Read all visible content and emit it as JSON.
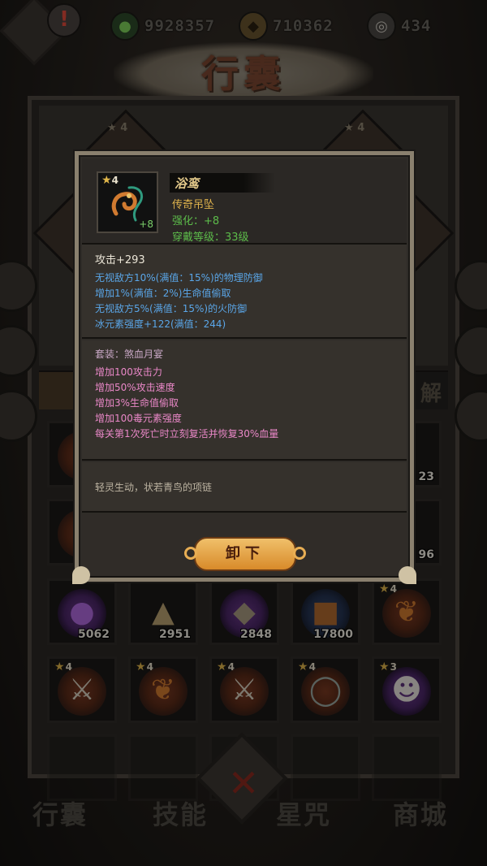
{
  "resources": {
    "jade": "9928357",
    "coin": "710362",
    "spirit": "434"
  },
  "header": {
    "title": "行囊"
  },
  "background": {
    "equip_star_left": "4",
    "equip_star_right": "4",
    "tab_right_label": "解"
  },
  "grid": {
    "row1": [
      {
        "name": "bag-slot",
        "count": ""
      },
      {
        "name": "bag-slot",
        "count": ""
      },
      {
        "name": "bag-slot",
        "count": ""
      },
      {
        "name": "bag-slot",
        "count": ""
      },
      {
        "name": "bag-slot",
        "count": "23"
      }
    ],
    "row2": [
      {
        "name": "bag-slot",
        "count": ""
      },
      {
        "name": "bag-slot",
        "count": ""
      },
      {
        "name": "bag-slot",
        "count": ""
      },
      {
        "name": "bag-slot",
        "count": ""
      },
      {
        "name": "bag-slot",
        "count": "96"
      }
    ],
    "row3": [
      {
        "name": "purple-orb",
        "count": "5062"
      },
      {
        "name": "rice-sack",
        "count": "2951"
      },
      {
        "name": "fish",
        "count": "2848"
      },
      {
        "name": "meat-bowl",
        "count": "17800"
      },
      {
        "name": "pendant",
        "star": "4",
        "count": ""
      }
    ],
    "row4": [
      {
        "name": "sword",
        "star": "4"
      },
      {
        "name": "pendant",
        "star": "4"
      },
      {
        "name": "sword",
        "star": "4"
      },
      {
        "name": "ring",
        "star": "4"
      },
      {
        "name": "demon-mask",
        "star": "3"
      }
    ]
  },
  "bottom_nav": [
    "行囊",
    "技能",
    "星咒",
    "商城"
  ],
  "popup": {
    "star": "4",
    "plus": "+8",
    "name": "浴鸾",
    "type": "传奇吊坠",
    "enhance": "强化：+8",
    "level": "穿戴等级：33级",
    "base_attr": "攻击+293",
    "attrs": [
      "无视敌方10%(满值：15%)的物理防御",
      "增加1%(满值：2%)生命值偷取",
      "无视敌方5%(满值：15%)的火防御",
      "冰元素强度+122(满值：244)"
    ],
    "set_name": "套装：煞血月宴",
    "set_effects": [
      "增加100攻击力",
      "增加50%攻击速度",
      "增加3%生命值偷取",
      "增加100毒元素强度",
      "每关第1次死亡时立刻复活并恢复30%血量"
    ],
    "description": "轻灵生动，状若青鸟的项链",
    "unequip_label": "卸下"
  },
  "colors": {
    "attr_blue": "#5aa6e8",
    "set_pink": "#ea88c8",
    "green": "#5cbb4a",
    "gold": "#e0b34c"
  }
}
